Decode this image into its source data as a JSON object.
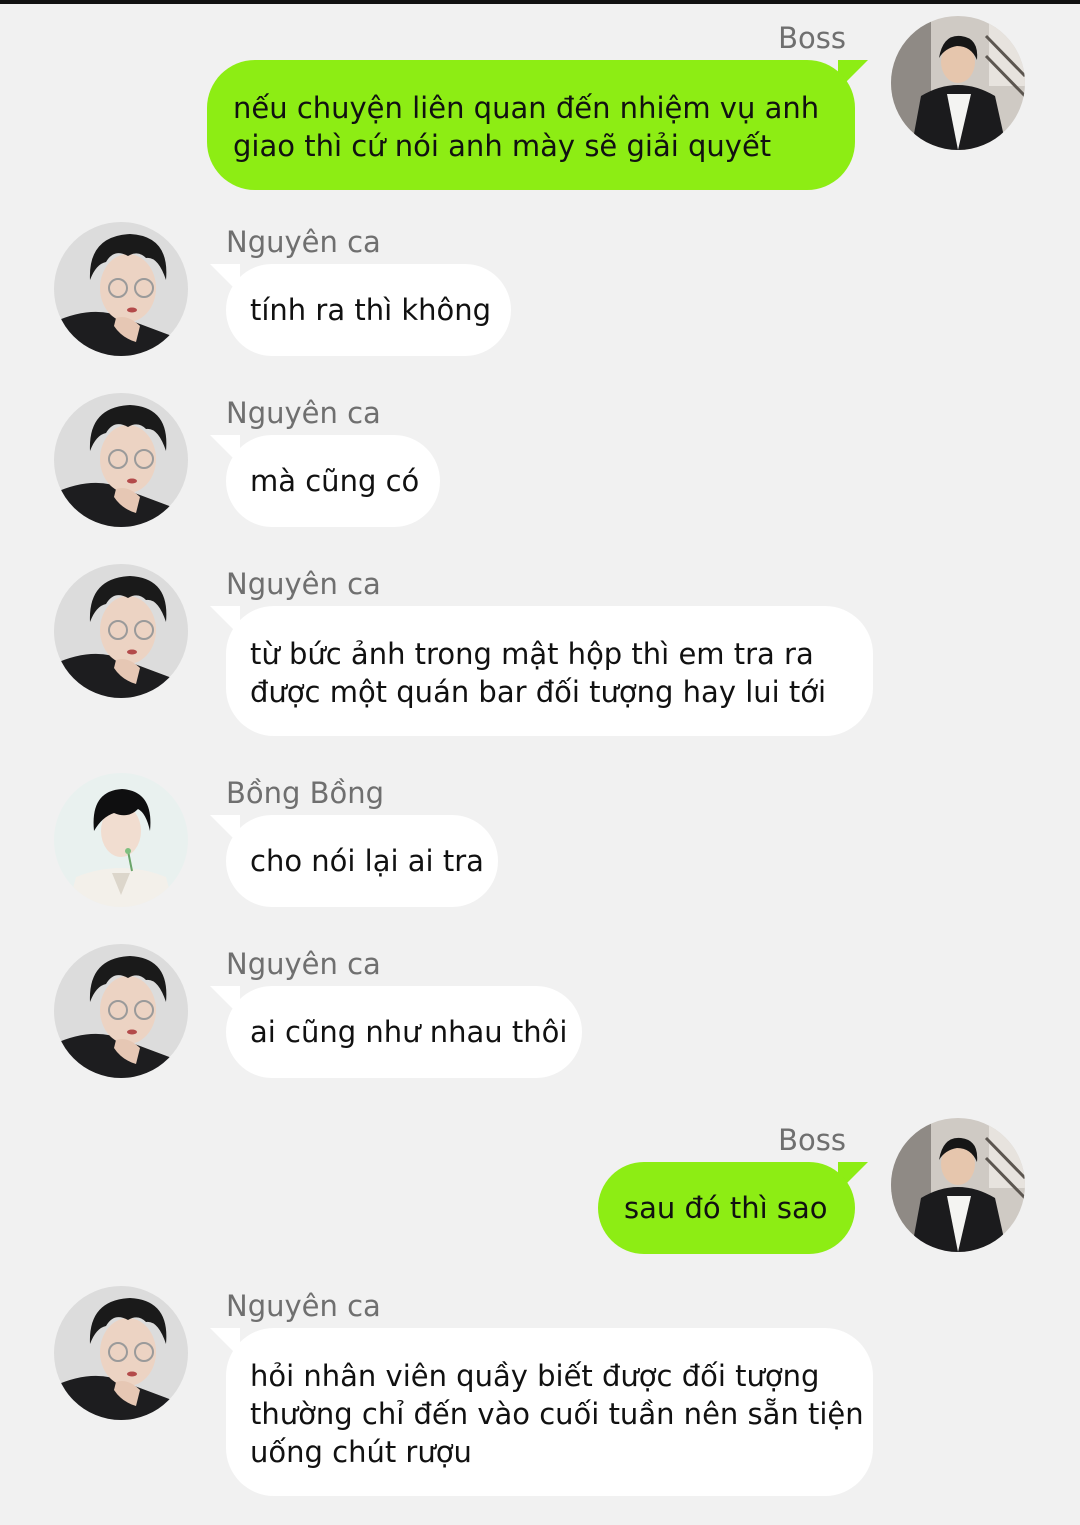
{
  "colors": {
    "background": "#f1f1f1",
    "sent_bubble": "#8ded14",
    "received_bubble": "#ffffff",
    "name_text": "#6f6f6f",
    "message_text": "#111111"
  },
  "messages": [
    {
      "sender": "Boss",
      "side": "right",
      "avatar": "boss-avatar-icon",
      "lines": [
        "nếu chuyện liên quan đến nhiệm vụ anh",
        "giao thì cứ nói anh mày sẽ giải quyết"
      ]
    },
    {
      "sender": "Nguyên ca",
      "side": "left",
      "avatar": "nguyen-ca-avatar-icon",
      "lines": [
        "tính ra thì không"
      ]
    },
    {
      "sender": "Nguyên ca",
      "side": "left",
      "avatar": "nguyen-ca-avatar-icon",
      "lines": [
        "mà cũng có"
      ]
    },
    {
      "sender": "Nguyên ca",
      "side": "left",
      "avatar": "nguyen-ca-avatar-icon",
      "lines": [
        "từ bức ảnh trong mật hộp thì em tra ra",
        "được một quán bar đối tượng hay lui tới"
      ]
    },
    {
      "sender": "Bồng Bồng",
      "side": "left",
      "avatar": "bong-bong-avatar-icon",
      "lines": [
        "cho nói lại ai tra"
      ]
    },
    {
      "sender": "Nguyên ca",
      "side": "left",
      "avatar": "nguyen-ca-avatar-icon",
      "lines": [
        "ai cũng như nhau thôi"
      ]
    },
    {
      "sender": "Boss",
      "side": "right",
      "avatar": "boss-avatar-icon",
      "lines": [
        "sau đó thì sao"
      ]
    },
    {
      "sender": "Nguyên ca",
      "side": "left",
      "avatar": "nguyen-ca-avatar-icon",
      "lines": [
        "hỏi nhân viên quầy biết được đối tượng",
        "thường chỉ đến vào cuối tuần nên sẵn tiện",
        "uống chút rượu"
      ]
    }
  ]
}
